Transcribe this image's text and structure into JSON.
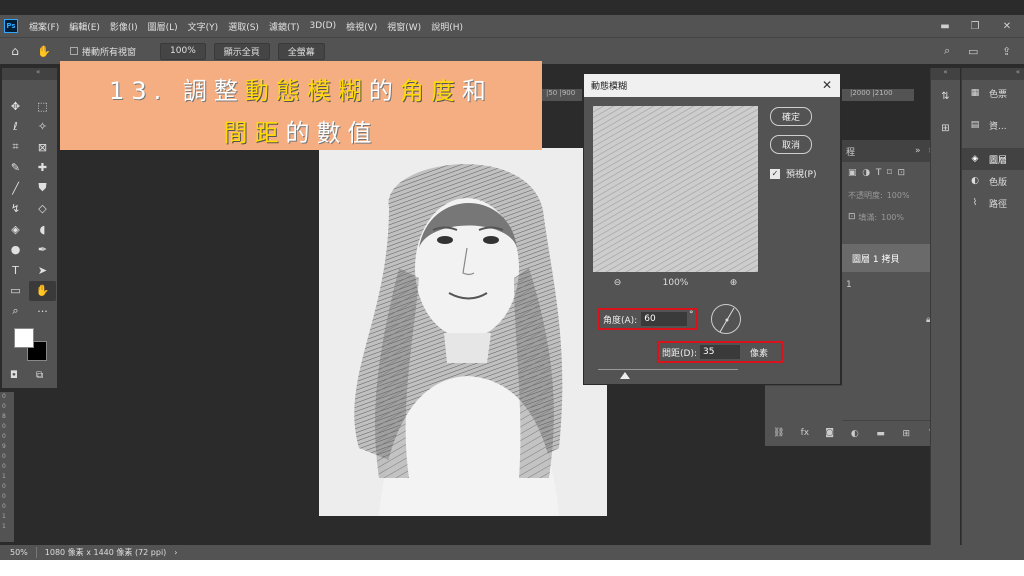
{
  "app": {
    "logo": "Ps"
  },
  "menu": [
    "檔案(F)",
    "編輯(E)",
    "影像(I)",
    "圖層(L)",
    "文字(Y)",
    "選取(S)",
    "濾鏡(T)",
    "3D(D)",
    "檢視(V)",
    "視窗(W)",
    "說明(H)"
  ],
  "window_controls": {
    "minimize": "▬",
    "restore": "❐",
    "close": "✕"
  },
  "options_bar": {
    "scroll_all": "捲動所有視窗",
    "zoom": "100%",
    "fit_screen": "顯示全頁",
    "fill_screen": "全螢幕"
  },
  "banner": {
    "prefix": "13. 調整",
    "highlight1": "動態模糊",
    "mid": "的",
    "highlight2": "角度",
    "suffix": "和",
    "line2_highlight": "間距",
    "line2_mid": "的",
    "line2_suffix": "數值"
  },
  "rulers": {
    "top_left": "|50  |900",
    "top_right": "|2000  |2100",
    "left": [
      "0",
      "0",
      "8",
      "0",
      "0",
      "9",
      "0",
      "0",
      "1",
      "0",
      "0",
      "0",
      "1",
      "1",
      "0",
      "0"
    ]
  },
  "dialog": {
    "title": "動態模糊",
    "ok": "確定",
    "cancel": "取消",
    "preview_label": "預視(P)",
    "preview_checked": "✓",
    "zoom_level": "100%",
    "angle_label": "角度(A):",
    "angle_value": "60",
    "angle_unit": "°",
    "distance_label": "間距(D):",
    "distance_value": "35",
    "distance_unit": "像素"
  },
  "layers_panel": {
    "tab_fragment": "程",
    "opacity_label": "不透明度:",
    "opacity_value": "100%",
    "fill_label": "填滿:",
    "fill_value": "100%",
    "layer_name": "圖層 1 拷貝",
    "layer_fragment": "1"
  },
  "right_panel": {
    "items": [
      {
        "icon": "▦",
        "label": "色票"
      },
      {
        "icon": "▤",
        "label": "資..."
      },
      {
        "icon": "◈",
        "label": "圖層"
      },
      {
        "icon": "◐",
        "label": "色版"
      },
      {
        "icon": "⌇",
        "label": "路徑"
      }
    ]
  },
  "status": {
    "zoom": "50%",
    "doc_info": "1080 像素 x 1440 像素 (72 ppi)",
    "arrow": "›"
  },
  "colors": {
    "banner_bg": "#f4ae82",
    "highlight_yellow": "#ffd90a",
    "red_outline": "#d8131b",
    "panel_bg": "#535353",
    "canvas_bg": "#2b2b2b"
  }
}
